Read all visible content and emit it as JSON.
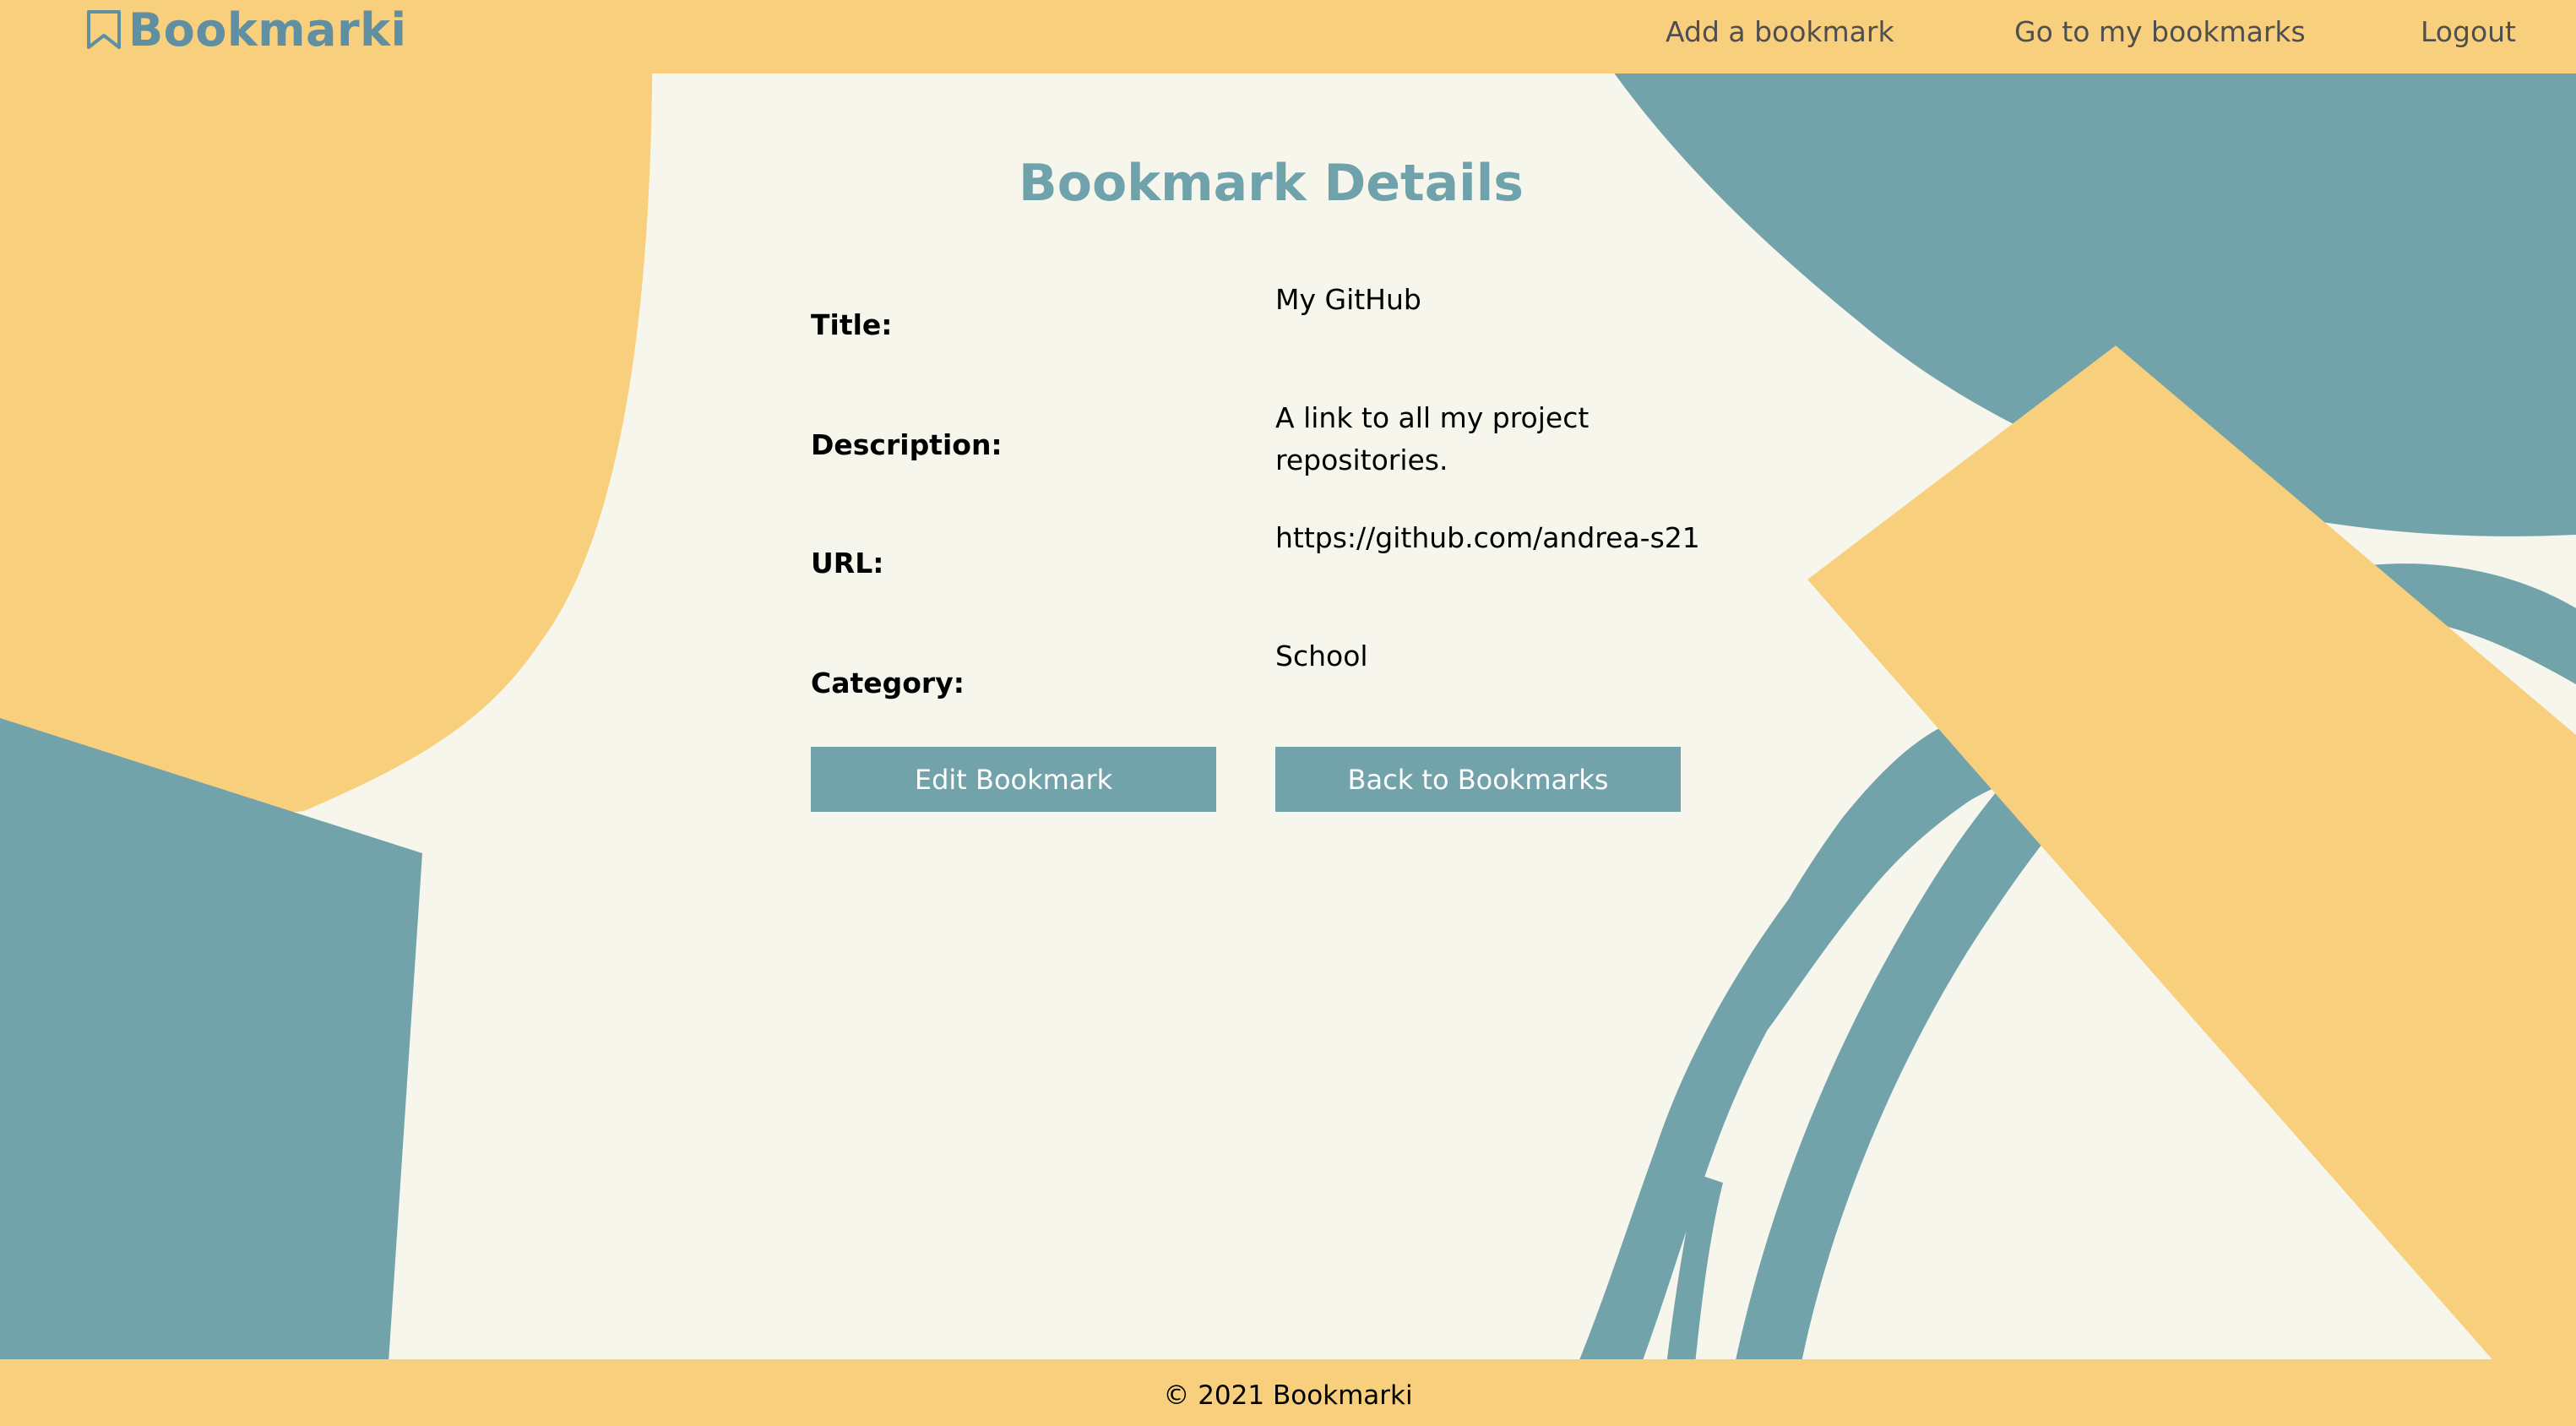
{
  "navbar": {
    "brand": "Bookmarki",
    "brand_icon": "bookmark-icon",
    "links": {
      "add": "Add a bookmark",
      "go": "Go to my bookmarks",
      "logout": "Logout"
    }
  },
  "main": {
    "title": "Bookmark Details",
    "fields": {
      "title": {
        "label": "Title:",
        "value": "My GitHub"
      },
      "description": {
        "label": "Description:",
        "value": "A link to all my project repositories."
      },
      "url": {
        "label": "URL:",
        "value": "https://github.com/andrea-s21"
      },
      "category": {
        "label": "Category:",
        "value": "School"
      }
    },
    "buttons": {
      "edit": "Edit Bookmark",
      "back": "Back to Bookmarks"
    }
  },
  "footer": {
    "text": "© 2021 Bookmarki"
  },
  "colors": {
    "yellow": "#f8cf7c",
    "teal": "#72a3ab",
    "background": "#f7f6ec",
    "title": "#6fa2ab"
  }
}
